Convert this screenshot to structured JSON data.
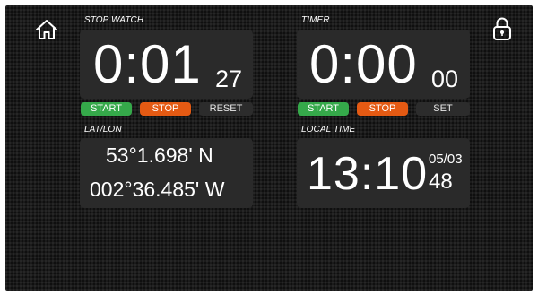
{
  "icons": {
    "home": "home-icon",
    "lock": "padlock-icon"
  },
  "stopwatch": {
    "label": "STOP WATCH",
    "main": "0:01",
    "fraction": "27",
    "buttons": {
      "start": "START",
      "stop": "STOP",
      "reset": "RESET"
    }
  },
  "timer": {
    "label": "TIMER",
    "main": "0:00",
    "fraction": "00",
    "buttons": {
      "start": "START",
      "stop": "STOP",
      "set": "SET"
    }
  },
  "latlon": {
    "label": "LAT/LON",
    "lat": "53°1.698' N",
    "lon": "002°36.485' W"
  },
  "local_time": {
    "label": "LOCAL TIME",
    "hhmm": "13:10",
    "date": "05/03",
    "seconds": "48"
  },
  "colors": {
    "start": "#35a94a",
    "stop": "#e45a13",
    "panel": "#2a2a2a",
    "background": "#1b1b1b"
  }
}
